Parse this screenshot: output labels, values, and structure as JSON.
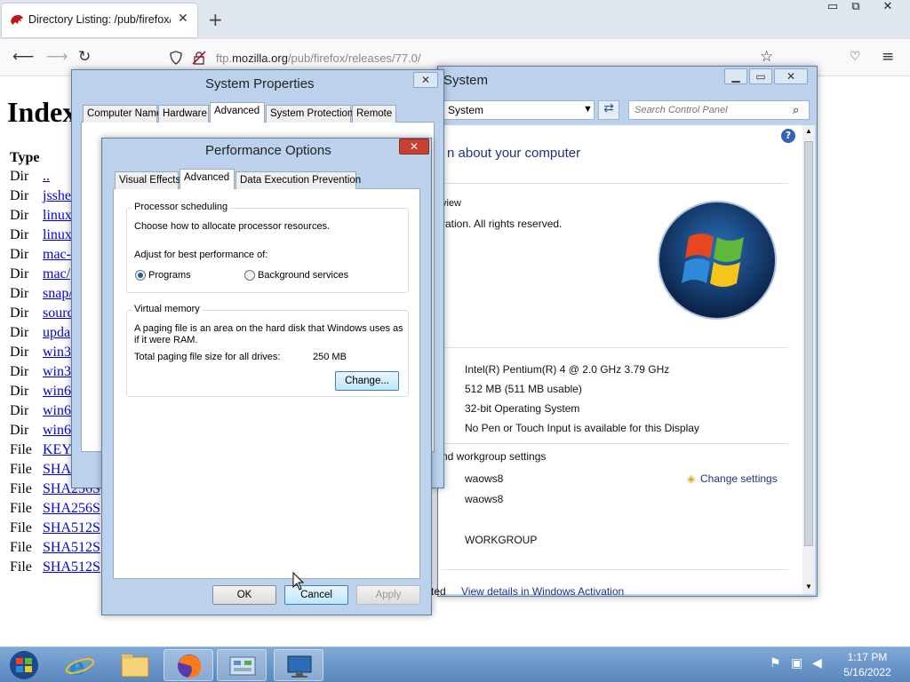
{
  "firefox": {
    "tab_title": "Directory Listing: /pub/firefox/r",
    "url_prefix": "ftp.",
    "url_domain": "mozilla.org",
    "url_path": "/pub/firefox/releases/77.0/",
    "close_glyph": "✕",
    "new_tab_glyph": "+",
    "win_min": "▭",
    "win_max": "⧉",
    "win_close": "✕"
  },
  "page": {
    "heading": "Index",
    "type_header": "Type",
    "rows": [
      {
        "type": "Dir",
        "name": ".."
      },
      {
        "type": "Dir",
        "name": "jsshe"
      },
      {
        "type": "Dir",
        "name": "linux"
      },
      {
        "type": "Dir",
        "name": "linux"
      },
      {
        "type": "Dir",
        "name": "mac-"
      },
      {
        "type": "Dir",
        "name": "mac/"
      },
      {
        "type": "Dir",
        "name": "snap/"
      },
      {
        "type": "Dir",
        "name": "sourc"
      },
      {
        "type": "Dir",
        "name": "upda"
      },
      {
        "type": "Dir",
        "name": "win3"
      },
      {
        "type": "Dir",
        "name": "win3"
      },
      {
        "type": "Dir",
        "name": "win6"
      },
      {
        "type": "Dir",
        "name": "win6"
      },
      {
        "type": "Dir",
        "name": "win6"
      },
      {
        "type": "File",
        "name": "KEY"
      },
      {
        "type": "File",
        "name": "SHA"
      },
      {
        "type": "File",
        "name": "SHA256S"
      },
      {
        "type": "File",
        "name": "SHA256S"
      },
      {
        "type": "File",
        "name": "SHA512S"
      },
      {
        "type": "File",
        "name": "SHA512S"
      },
      {
        "type": "File",
        "name": "SHA512S"
      }
    ]
  },
  "system_window": {
    "title": "System",
    "address": "System",
    "search_placeholder": "Search Control Panel",
    "heading": "n about your computer",
    "edition_label": "view",
    "copyright": "ration. All rights reserved.",
    "processor": "Intel(R) Pentium(R) 4   @ 2.0 GHz   3.79 GHz",
    "memory": "512 MB (511 MB usable)",
    "system_type": "32-bit Operating System",
    "pen_touch": "No Pen or Touch Input is available for this Display",
    "section_workgroup": "nd workgroup settings",
    "computer_name": "waows8",
    "full_name": "waows8",
    "workgroup": "WORKGROUP",
    "change_settings": "Change settings",
    "activation_prefix": "ted",
    "activation_link": "View details in Windows Activation",
    "help_glyph": "?"
  },
  "system_properties": {
    "title": "System Properties",
    "tabs": [
      "Computer Name",
      "Hardware",
      "Advanced",
      "System Protection",
      "Remote"
    ],
    "active_tab": "Advanced"
  },
  "performance_options": {
    "title": "Performance Options",
    "tabs": [
      "Visual Effects",
      "Advanced",
      "Data Execution Prevention"
    ],
    "active_tab": "Advanced",
    "processor_group": "Processor scheduling",
    "processor_desc": "Choose how to allocate processor resources.",
    "adjust_label": "Adjust for best performance of:",
    "radio_programs": "Programs",
    "radio_background": "Background services",
    "selected": "Programs",
    "vm_group": "Virtual memory",
    "vm_desc_1": "A paging file is an area on the hard disk that Windows uses as",
    "vm_desc_2": "if it were RAM.",
    "vm_total_label": "Total paging file size for all drives:",
    "vm_total_value": "250 MB",
    "change_button": "Change...",
    "ok": "OK",
    "cancel": "Cancel",
    "apply": "Apply"
  },
  "taskbar": {
    "time": "1:17 PM",
    "date": "5/16/2022"
  }
}
